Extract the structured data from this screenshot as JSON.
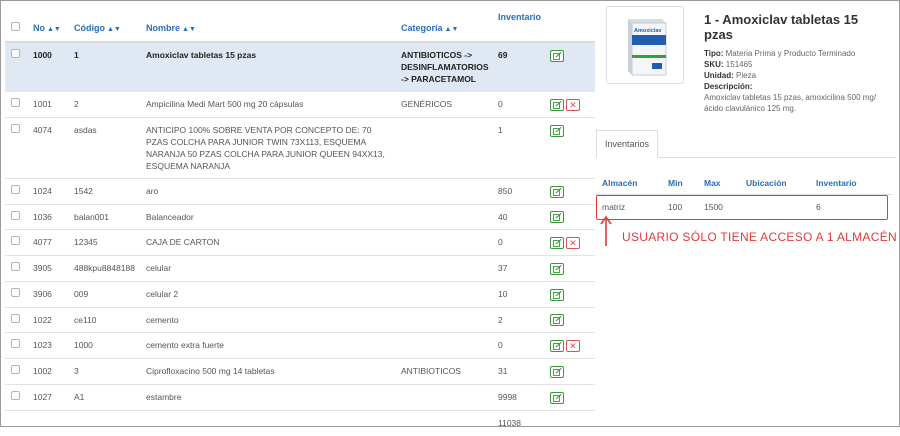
{
  "table": {
    "headers": {
      "no": "No",
      "codigo": "Código",
      "nombre": "Nombre",
      "categoria": "Categoría",
      "inventario": "Inventario"
    },
    "rows": [
      {
        "no": "1000",
        "codigo": "1",
        "nombre": "Amoxiclav tabletas 15 pzas",
        "categoria": "ANTIBIOTICOS -> DESINFLAMATORIOS -> PARACETAMOL",
        "inventario": "69",
        "deletable": false,
        "selected": true
      },
      {
        "no": "1001",
        "codigo": "2",
        "nombre": "Ampicilina Medi Mart 500 mg 20 cápsulas",
        "categoria": "GENÉRICOS",
        "inventario": "0",
        "deletable": true
      },
      {
        "no": "4074",
        "codigo": "asdas",
        "nombre": "ANTICIPO 100% SOBRE VENTA POR CONCEPTO DE: 70 PZAS COLCHA PARA JUNIOR TWIN 73X113, ESQUEMA NARANJA 50 PZAS COLCHA PARA JUNIOR QUEEN 94XX13, ESQUEMA NARANJA",
        "categoria": "",
        "inventario": "1",
        "deletable": false
      },
      {
        "no": "1024",
        "codigo": "1542",
        "nombre": "aro",
        "categoria": "",
        "inventario": "850",
        "deletable": false
      },
      {
        "no": "1036",
        "codigo": "balan001",
        "nombre": "Balanceador",
        "categoria": "",
        "inventario": "40",
        "deletable": false
      },
      {
        "no": "4077",
        "codigo": "12345",
        "nombre": "CAJA DE CARTON",
        "categoria": "",
        "inventario": "0",
        "deletable": true
      },
      {
        "no": "3905",
        "codigo": "488kpu8848188",
        "nombre": "celular",
        "categoria": "",
        "inventario": "37",
        "deletable": false
      },
      {
        "no": "3906",
        "codigo": "009",
        "nombre": "celular 2",
        "categoria": "",
        "inventario": "10",
        "deletable": false
      },
      {
        "no": "1022",
        "codigo": "ce110",
        "nombre": "cemento",
        "categoria": "",
        "inventario": "2",
        "deletable": false
      },
      {
        "no": "1023",
        "codigo": "1000",
        "nombre": "cemento extra fuerte",
        "categoria": "",
        "inventario": "0",
        "deletable": true
      },
      {
        "no": "1002",
        "codigo": "3",
        "nombre": "Ciprofloxacino 500 mg 14 tabletas",
        "categoria": "ANTIBIOTICOS",
        "inventario": "31",
        "deletable": false
      },
      {
        "no": "1027",
        "codigo": "A1",
        "nombre": "estambre",
        "categoria": "",
        "inventario": "9998",
        "deletable": false
      }
    ],
    "total_inventario": "11038"
  },
  "product": {
    "title": "1 - Amoxiclav tabletas 15 pzas",
    "tipo_label": "Tipo:",
    "tipo": "Materia Prima y Producto Terminado",
    "sku_label": "SKU:",
    "sku": "151465",
    "unidad_label": "Unidad:",
    "unidad": "Pieza",
    "descripcion_label": "Descripción:",
    "descripcion": "Amoxiclav tabletas 15 pzas, amoxicilina 500 mg/ácido clavulánico 125 mg.",
    "box_brand": "Amoxiclav"
  },
  "inventarios": {
    "tab_label": "Inventarios",
    "headers": {
      "almacen": "Almacén",
      "min": "Min",
      "max": "Max",
      "ubicacion": "Ubicación",
      "inventario": "Inventario"
    },
    "rows": [
      {
        "almacen": "matriz",
        "min": "100",
        "max": "1500",
        "ubicacion": "",
        "inventario": "6"
      }
    ]
  },
  "annotation": {
    "text": "USUARIO SÓLO TIENE ACCESO A 1 ALMACÉN",
    "color": "#e03b3b"
  },
  "colors": {
    "accent": "#2a6fb6",
    "selected_row": "#dfe8f3",
    "edit_button": "#3a9a3a",
    "delete_button": "#d9534f"
  }
}
